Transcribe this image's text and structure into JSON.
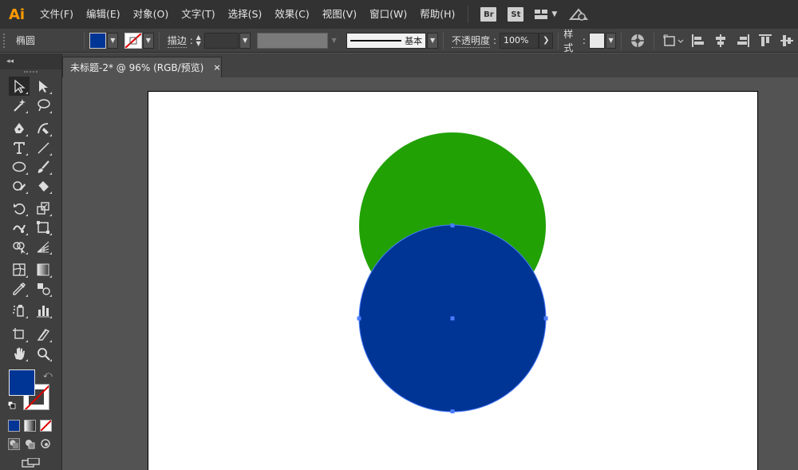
{
  "app": {
    "logo": "Ai"
  },
  "menu": [
    "文件(F)",
    "编辑(E)",
    "对象(O)",
    "文字(T)",
    "选择(S)",
    "效果(C)",
    "视图(V)",
    "窗口(W)",
    "帮助(H)"
  ],
  "menu_badges": {
    "bridge": "Br",
    "stock": "St"
  },
  "control": {
    "object_type": "椭圆",
    "stroke_label": "描边",
    "stroke_weight": "",
    "stroke_profile": "基本",
    "opacity_label": "不透明度",
    "opacity_value": "100%",
    "style_label": "样式"
  },
  "document": {
    "tab_title": "未标题-2* @ 96% (RGB/预览)",
    "close_glyph": "×"
  },
  "colors": {
    "fill": "#003595",
    "green_circle": "#21a104",
    "blue_circle": "#003595",
    "selection": "#4a7cff"
  },
  "tools": [
    [
      "selection-tool",
      "direct-selection-tool"
    ],
    [
      "magic-wand-tool",
      "lasso-tool"
    ],
    [
      "pen-tool",
      "curvature-tool"
    ],
    [
      "type-tool",
      "line-segment-tool"
    ],
    [
      "ellipse-tool",
      "paintbrush-tool"
    ],
    [
      "shaper-tool",
      "eraser-tool"
    ],
    [
      "rotate-tool",
      "scale-tool"
    ],
    [
      "warp-tool",
      "free-transform-tool"
    ],
    [
      "shape-builder-tool",
      "perspective-grid-tool"
    ],
    [
      "mesh-tool",
      "gradient-tool"
    ],
    [
      "eyedropper-tool",
      "blend-tool"
    ],
    [
      "symbol-sprayer-tool",
      "column-graph-tool"
    ],
    [
      "artboard-tool",
      "slice-tool"
    ],
    [
      "hand-tool",
      "zoom-tool"
    ]
  ]
}
